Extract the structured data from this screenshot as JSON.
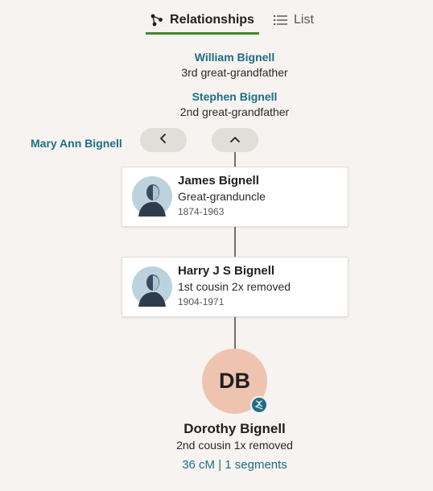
{
  "tabs": {
    "relationships_label": "Relationships",
    "list_label": "List"
  },
  "ancestors": [
    {
      "name": "William Bignell",
      "relationship": "3rd great-grandfather"
    },
    {
      "name": "Stephen Bignell",
      "relationship": "2nd great-grandfather"
    }
  ],
  "sibling_link": "Mary Ann Bignell",
  "cards": [
    {
      "name": "James Bignell",
      "relationship": "Great-granduncle",
      "dates": "1874-1963"
    },
    {
      "name": "Harry J S Bignell",
      "relationship": "1st cousin 2x removed",
      "dates": "1904-1971"
    }
  ],
  "match": {
    "initials": "DB",
    "name": "Dorothy Bignell",
    "relationship": "2nd cousin 1x removed",
    "dna": "36 cM | 1 segments"
  },
  "colors": {
    "accent_link": "#1f6e86",
    "tab_underline": "#3f8a2a",
    "match_avatar_bg": "#eec4b0",
    "background": "#f6f3f0"
  },
  "icons": {
    "relationships_tab": "tree-nodes-icon",
    "list_tab": "list-icon",
    "nav_left": "chevron-left-icon",
    "nav_up": "chevron-up-icon",
    "person_avatar": "person-silhouette-icon",
    "dna_badge": "dna-icon"
  }
}
